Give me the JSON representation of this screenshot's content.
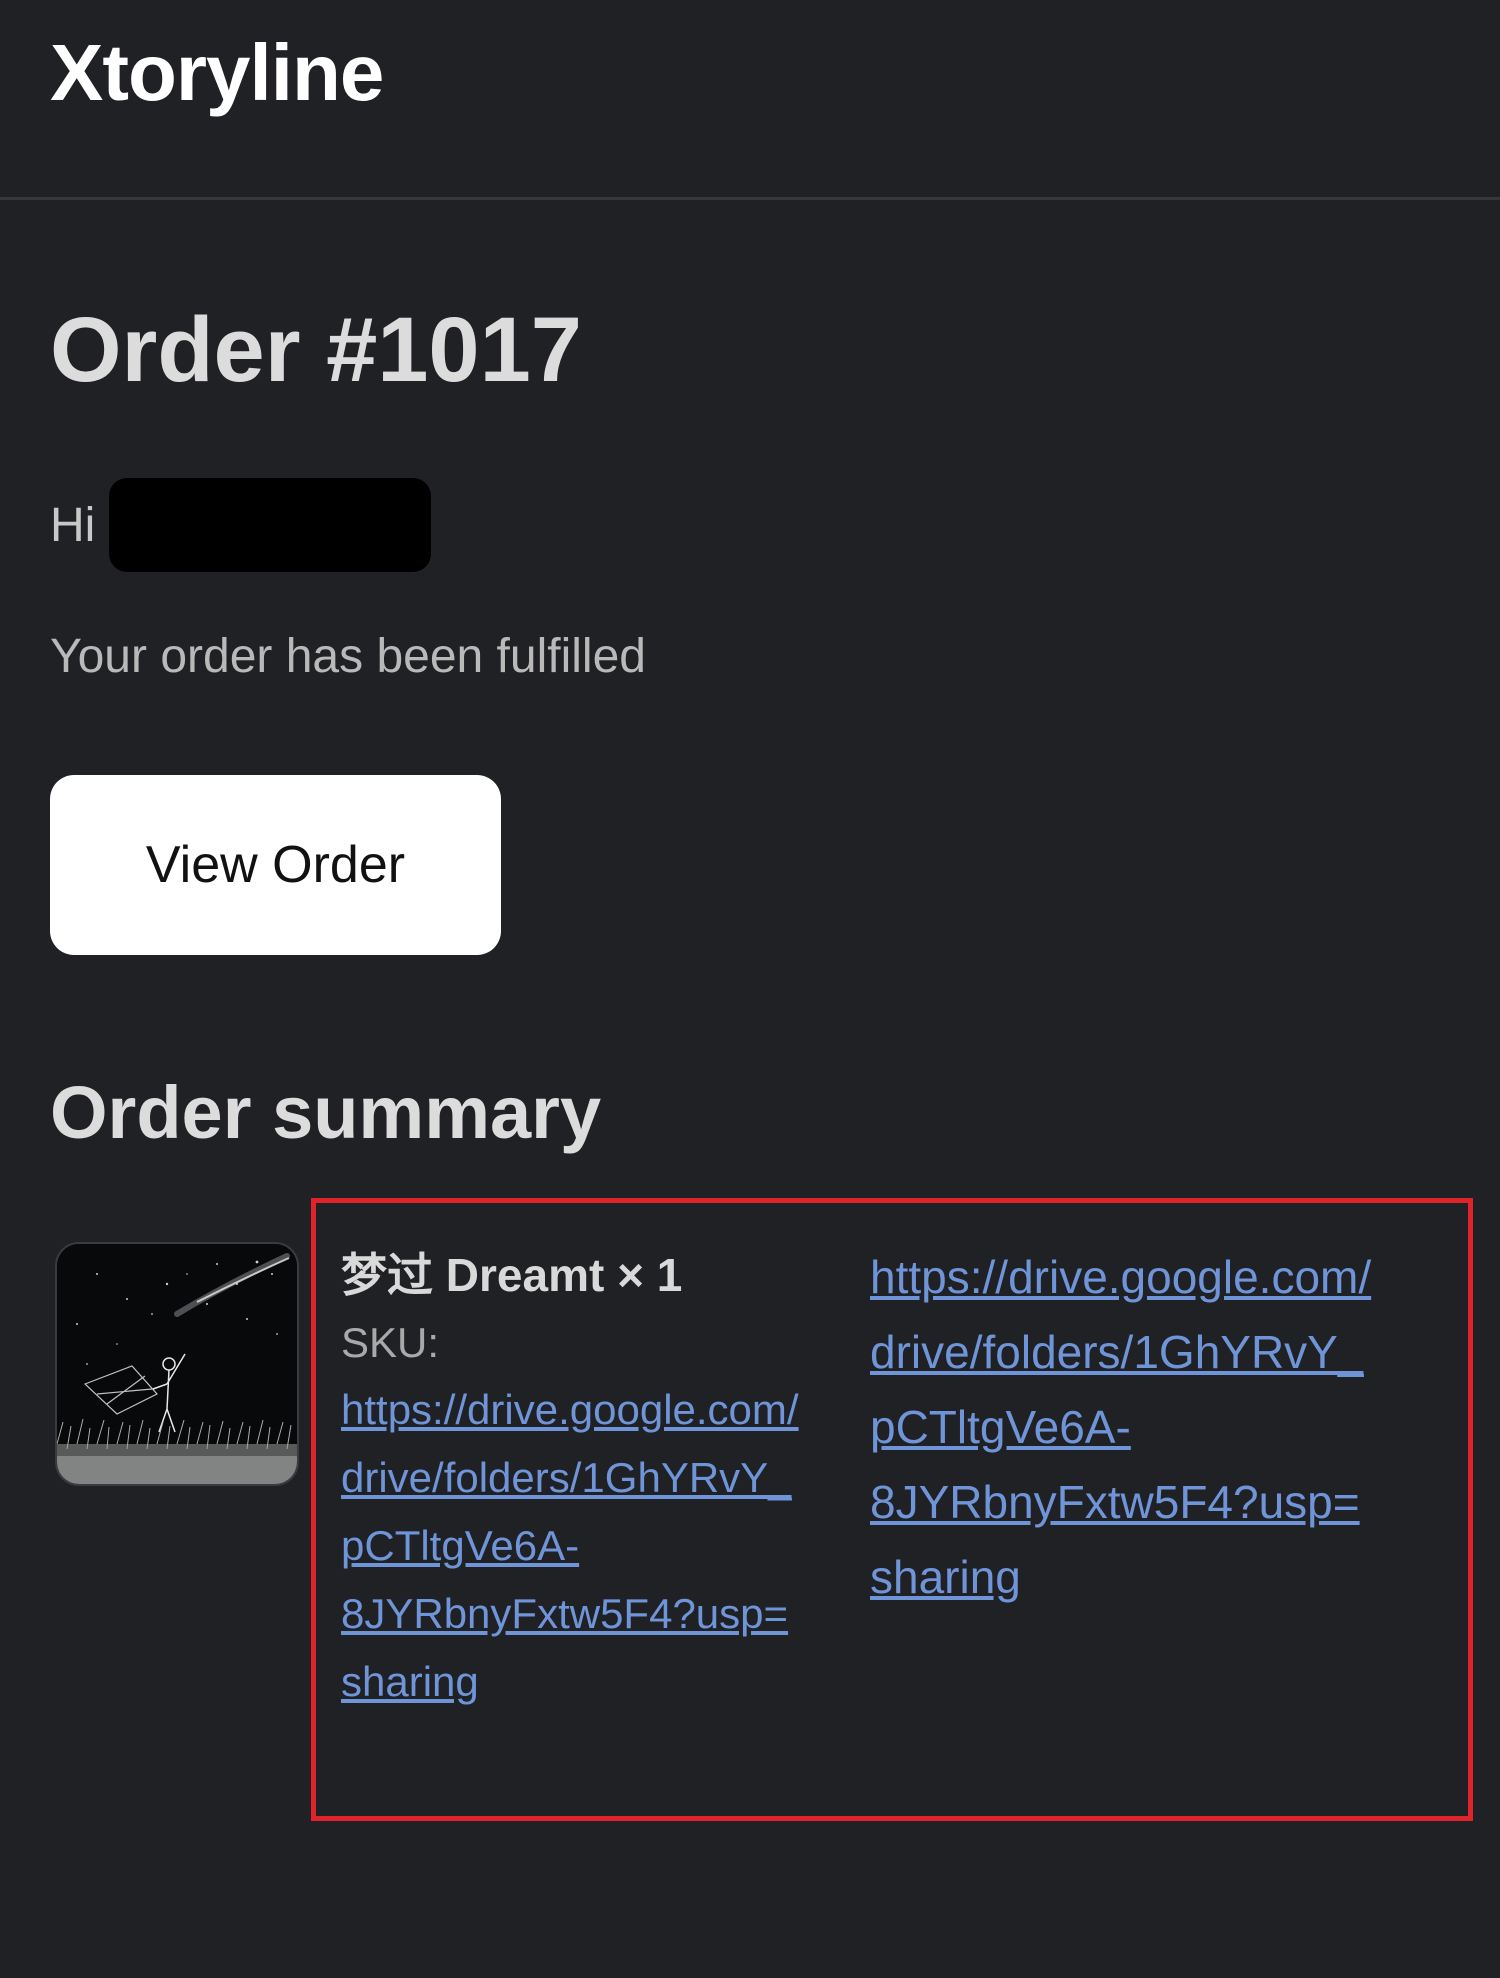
{
  "header": {
    "brand": "Xtoryline"
  },
  "order": {
    "title": "Order #1017",
    "greeting": "Hi",
    "status": "Your order has been fulfilled",
    "view_button": "View Order"
  },
  "summary": {
    "title": "Order summary",
    "item": {
      "name": "梦过 Dreamt × 1",
      "sku_label": "SKU:",
      "sku_lines": [
        "https://drive.google.com/",
        "drive/folders/1GhYRvY_",
        "pCTltgVe6A-",
        "8JYRbnyFxtw5F4?usp=",
        "sharing"
      ],
      "url_lines": [
        "https://drive.google.com/",
        "drive/folders/1GhYRvY_",
        "pCTltgVe6A-",
        "8JYRbnyFxtw5F4?usp=",
        "sharing"
      ]
    }
  },
  "colors": {
    "background": "#202125",
    "link": "#6f94d8",
    "highlight": "#e0222b",
    "button": "#ffffff"
  }
}
